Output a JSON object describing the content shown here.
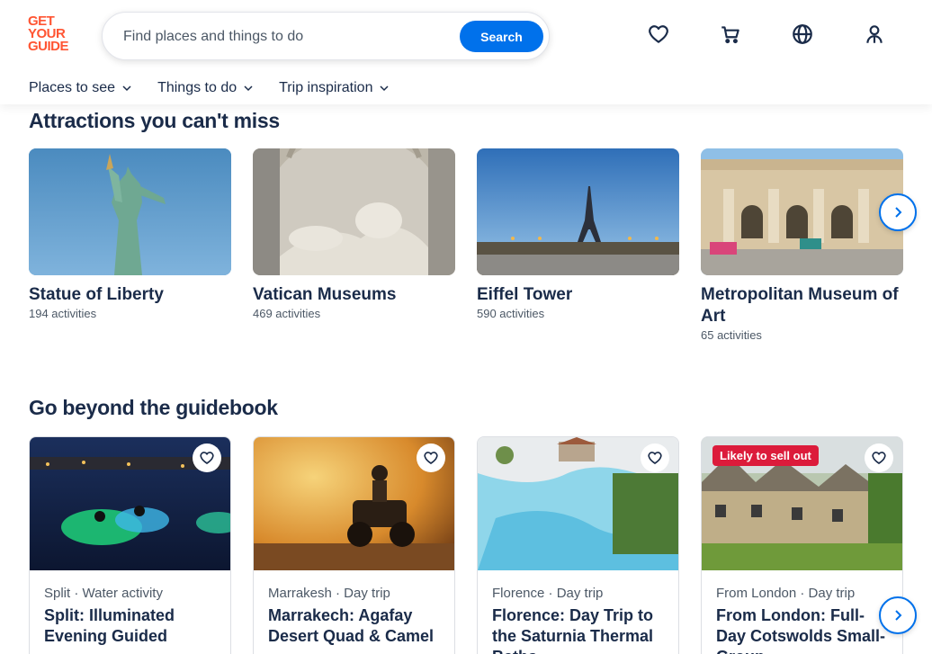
{
  "logo": {
    "line1": "GET",
    "line2": "YOUR",
    "line3": "GUIDE"
  },
  "search": {
    "placeholder": "Find places and things to do",
    "button_label": "Search"
  },
  "nav": [
    {
      "label": "Places to see"
    },
    {
      "label": "Things to do"
    },
    {
      "label": "Trip inspiration"
    }
  ],
  "attractions": {
    "title": "Attractions you can't miss",
    "items": [
      {
        "name": "Statue of Liberty",
        "count": "194 activities"
      },
      {
        "name": "Vatican Museums",
        "count": "469 activities"
      },
      {
        "name": "Eiffel Tower",
        "count": "590 activities"
      },
      {
        "name": "Metropolitan Museum of Art",
        "count": "65 activities"
      }
    ]
  },
  "guidebook": {
    "title": "Go beyond the guidebook",
    "items": [
      {
        "meta": "Split · Water activity",
        "title": "Split: Illuminated Evening Guided"
      },
      {
        "meta": "Marrakesh · Day trip",
        "title": "Marrakech: Agafay Desert Quad & Camel"
      },
      {
        "meta": "Florence · Day trip",
        "title": "Florence: Day Trip to the Saturnia Thermal Baths"
      },
      {
        "meta": "From London · Day trip",
        "title": "From London: Full-Day Cotswolds Small-Group",
        "badge": "Likely to sell out"
      }
    ]
  },
  "colors": {
    "brand": "#ff5533",
    "accent": "#0071eb",
    "text": "#1a2b49",
    "badge": "#dc1b3b"
  },
  "icons": {
    "wishlist": "heart-icon",
    "cart": "cart-icon",
    "language": "globe-icon",
    "profile": "person-icon"
  }
}
